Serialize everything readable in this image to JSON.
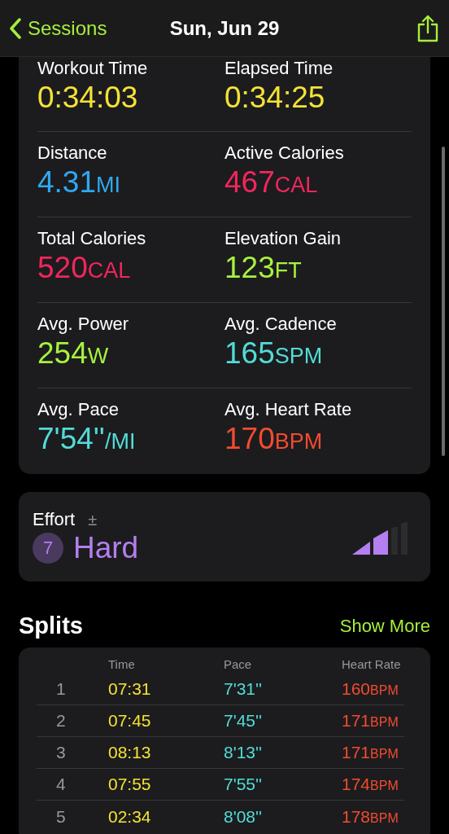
{
  "nav": {
    "back_label": "Sessions",
    "title": "Sun, Jun 29"
  },
  "metrics": [
    {
      "label": "Workout Time",
      "value": "0:34:03",
      "color": "#f4e236"
    },
    {
      "label": "Elapsed Time",
      "value": "0:34:25",
      "color": "#f4e236"
    },
    {
      "label": "Distance",
      "value": "4.31",
      "unit": "MI",
      "color": "#2fa9f2"
    },
    {
      "label": "Active Calories",
      "value": "467",
      "unit": "CAL",
      "color": "#f2265c"
    },
    {
      "label": "Total Calories",
      "value": "520",
      "unit": "CAL",
      "color": "#f2265c"
    },
    {
      "label": "Elevation Gain",
      "value": "123",
      "unit": "FT",
      "color": "#a7f23f"
    },
    {
      "label": "Avg. Power",
      "value": "254",
      "unit": "W",
      "color": "#a7f23f"
    },
    {
      "label": "Avg. Cadence",
      "value": "165",
      "unit": "SPM",
      "color": "#52dcd8"
    },
    {
      "label": "Avg. Pace",
      "value": "7'54''",
      "unit": "/MI",
      "color": "#52dcd8"
    },
    {
      "label": "Avg. Heart Rate",
      "value": "170",
      "unit": "BPM",
      "color": "#f24b30"
    }
  ],
  "effort": {
    "label": "Effort",
    "adjust": "±",
    "score": "7",
    "rating": "Hard"
  },
  "splits": {
    "title": "Splits",
    "action": "Show More",
    "columns": [
      "Time",
      "Pace",
      "Heart Rate"
    ],
    "rows": [
      {
        "index": "1",
        "time": "07:31",
        "pace": "7'31''",
        "hr": "160",
        "unit": "BPM"
      },
      {
        "index": "2",
        "time": "07:45",
        "pace": "7'45''",
        "hr": "171",
        "unit": "BPM"
      },
      {
        "index": "3",
        "time": "08:13",
        "pace": "8'13''",
        "hr": "171",
        "unit": "BPM"
      },
      {
        "index": "4",
        "time": "07:55",
        "pace": "7'55''",
        "hr": "174",
        "unit": "BPM"
      },
      {
        "index": "5",
        "time": "02:34",
        "pace": "8'08''",
        "hr": "178",
        "unit": "BPM"
      }
    ]
  }
}
